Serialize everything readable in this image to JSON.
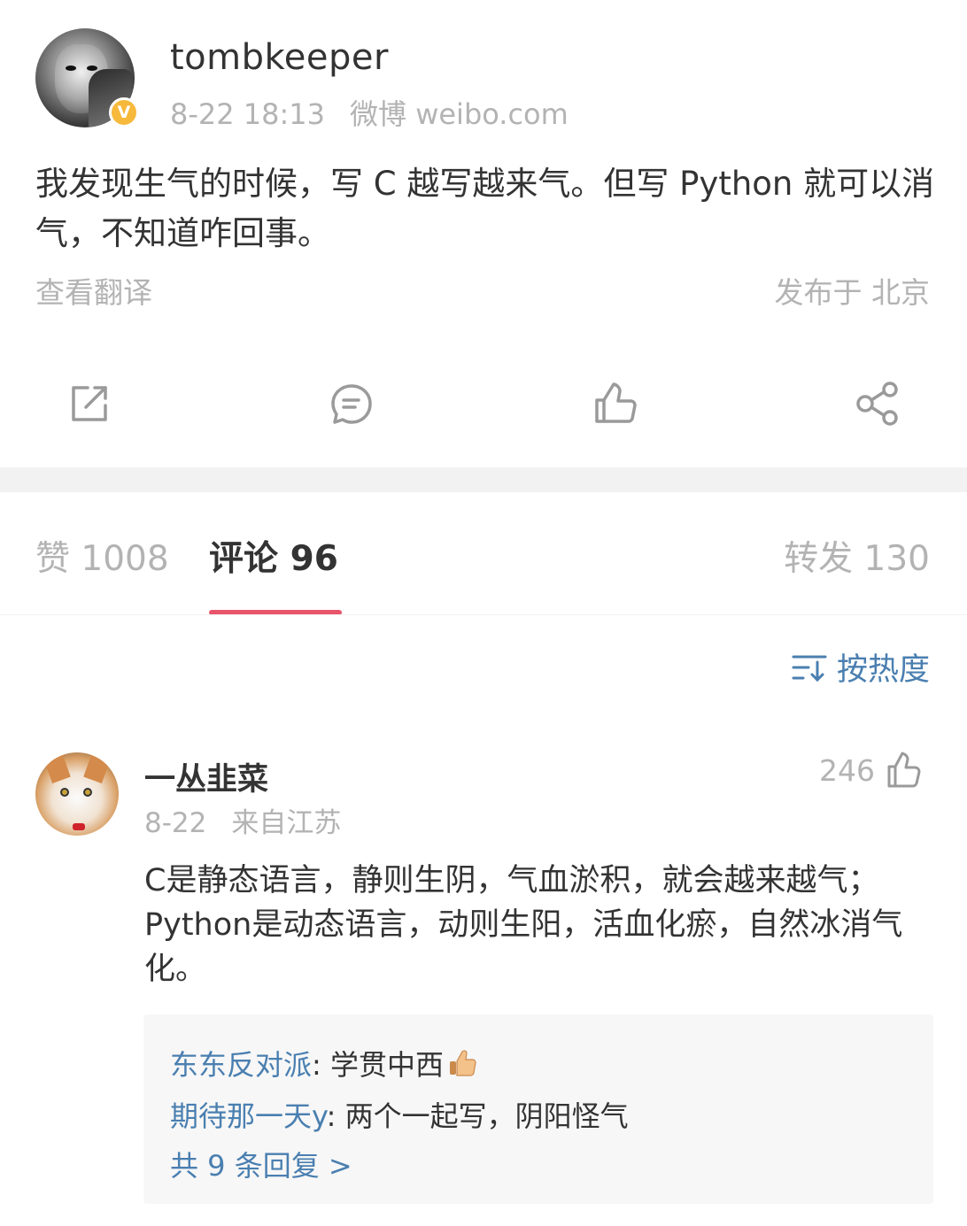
{
  "post": {
    "username": "tombkeeper",
    "date": "8-22 18:13",
    "source": "微博 weibo.com",
    "verified_badge": "V",
    "text": "我发现生气的时候，写 C 越写越来气。但写 Python 就可以消气，不知道咋回事。",
    "translate_link": "查看翻译",
    "location": "发布于 北京"
  },
  "actions": [
    {
      "icon": "repost-icon"
    },
    {
      "icon": "comment-icon"
    },
    {
      "icon": "like-icon"
    },
    {
      "icon": "share-icon"
    }
  ],
  "tabs": {
    "likes": "赞 1008",
    "comments": "评论 96",
    "reposts": "转发 130"
  },
  "sort": {
    "label": "按热度",
    "icon": "sort-icon"
  },
  "comment": {
    "username": "一丛韭菜",
    "date": "8-22",
    "location": "来自江苏",
    "likes": "246",
    "text": "C是静态语言，静则生阴，气血淤积，就会越来越气；Python是动态语言，动则生阳，活血化瘀，自然冰消气化。",
    "replies": [
      {
        "name": "东东反对派",
        "text": ": 学贯中西"
      },
      {
        "name": "期待那一天y",
        "text": ": 两个一起写，阴阳怪气"
      }
    ],
    "more_replies": "共 9 条回复 >"
  },
  "colors": {
    "accent_underline": "#e8546a",
    "link_blue": "#4a7fb0",
    "muted_gray": "#b3b3b3",
    "verified_gold": "#f6b93b"
  }
}
